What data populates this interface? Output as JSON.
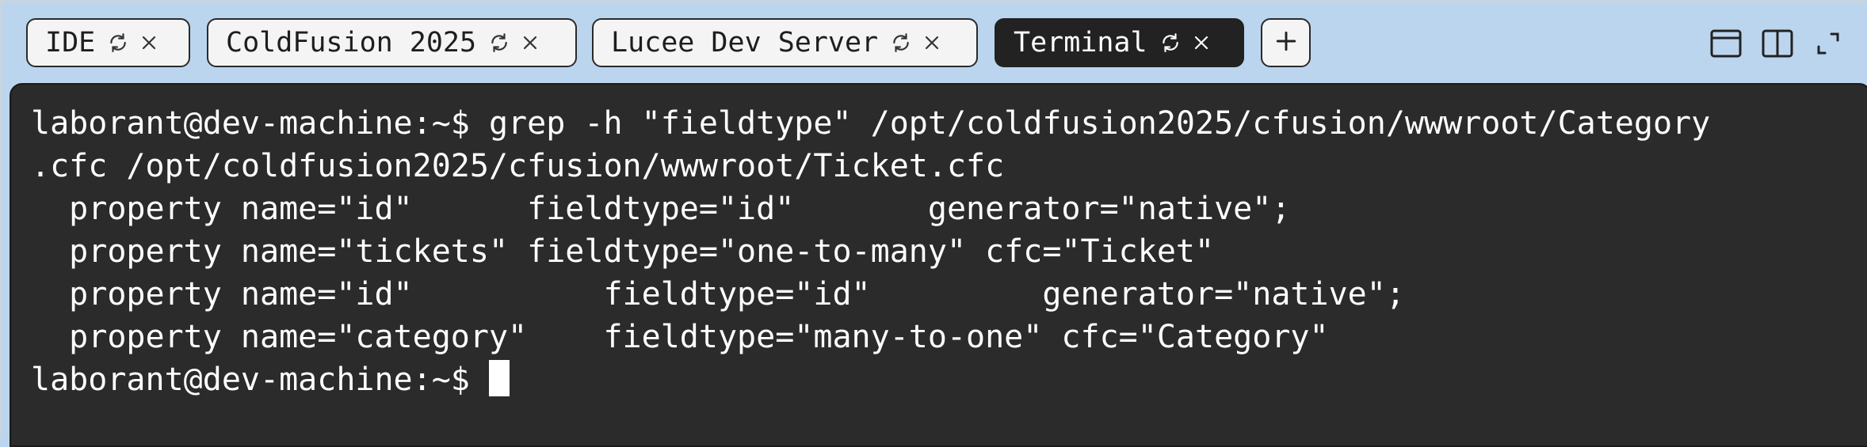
{
  "tabs": [
    {
      "label": "IDE",
      "active": false
    },
    {
      "label": "ColdFusion 2025",
      "active": false
    },
    {
      "label": "Lucee Dev Server",
      "active": false
    },
    {
      "label": "Terminal",
      "active": true
    }
  ],
  "new_tab_icon": "plus-icon",
  "window_controls": [
    "window-icon",
    "split-view-icon",
    "expand-icon"
  ],
  "terminal": {
    "lines": [
      "laborant@dev-machine:~$ grep -h \"fieldtype\" /opt/coldfusion2025/cfusion/wwwroot/Category",
      ".cfc /opt/coldfusion2025/cfusion/wwwroot/Ticket.cfc",
      "  property name=\"id\"      fieldtype=\"id\"       generator=\"native\";",
      "  property name=\"tickets\" fieldtype=\"one-to-many\" cfc=\"Ticket\"",
      "  property name=\"id\"          fieldtype=\"id\"         generator=\"native\";",
      "  property name=\"category\"    fieldtype=\"many-to-one\" cfc=\"Category\""
    ],
    "prompt": "laborant@dev-machine:~$ "
  }
}
